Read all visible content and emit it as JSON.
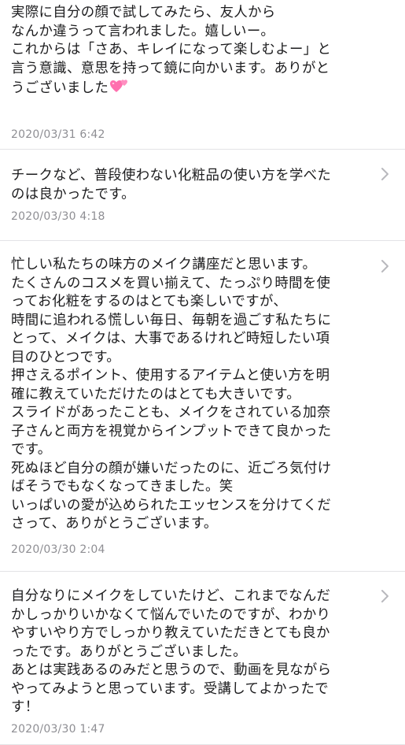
{
  "reviews": [
    {
      "lines": [
        "実際に自分の顔で試してみたら、友人から",
        "なんか違うって言われました。嬉しいー。",
        "これからは「さあ、キレイになって楽しむよー」と",
        "言う意識、意思を持って鏡に向かいます。ありがと",
        "うございました"
      ],
      "emoji": "two-hearts-icon",
      "date": "2020/03/31 6:42",
      "has_chevron": false
    },
    {
      "lines": [
        "チークなど、普段使わない化粧品の使い方を学べた",
        "のは良かったです。"
      ],
      "date": "2020/03/30 4:18",
      "has_chevron": true
    },
    {
      "lines": [
        "忙しい私たちの味方のメイク講座だと思います。",
        "たくさんのコスメを買い揃えて、たっぷり時間を使",
        "ってお化粧をするのはとても楽しいですが、",
        "時間に追われる慌しい毎日、毎朝を過ごす私たちに",
        "とって、メイクは、大事であるけれど時短したい項",
        "目のひとつです。",
        "押さえるポイント、使用するアイテムと使い方を明",
        "確に教えていただけたのはとても大きいです。",
        "スライドがあったことも、メイクをされている加奈",
        "子さんと両方を視覚からインプットできて良かった",
        "です。",
        "死ぬほど自分の顔が嫌いだったのに、近ごろ気付け",
        "ばそうでもなくなってきました。笑",
        "いっぱいの愛が込められたエッセンスを分けてくだ",
        "さって、ありがとうございます。"
      ],
      "date": "2020/03/30 2:04",
      "has_chevron": true
    },
    {
      "lines": [
        "自分なりにメイクをしていたけど、これまでなんだ",
        "かしっかりいかなくて悩んでいたのですが、わかり",
        "やすいやり方でしっかり教えていただきとても良か",
        "ったです。ありがとうございました。",
        "あとは実践あるのみだと思うので、動画を見ながら",
        "やってみようと思っています。受講してよかったで",
        "す！"
      ],
      "date": "2020/03/30 1:47",
      "has_chevron": true
    }
  ],
  "colors": {
    "text": "#1c1c1e",
    "date": "#8e8e93",
    "divider": "#e3e3e6",
    "chevron": "#b8b8bd",
    "heart": "#ff6fae"
  }
}
